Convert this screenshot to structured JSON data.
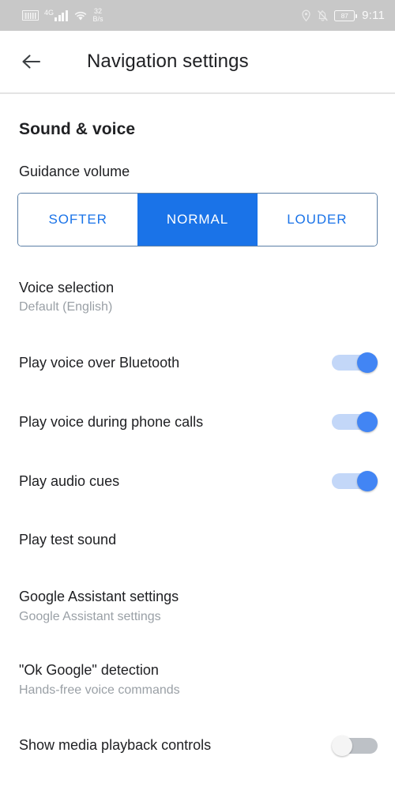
{
  "statusbar": {
    "sim_icon": "sim-card-icon",
    "network_label": "4G",
    "signal_icon": "signal-bars-icon",
    "wifi_icon": "wifi-icon",
    "data_rate_value": "32",
    "data_rate_unit": "B/s",
    "location_icon": "location-pin-icon",
    "notifications_muted_icon": "bell-muted-icon",
    "battery_icon": "battery-icon",
    "battery_level": "87",
    "time": "9:11"
  },
  "appbar": {
    "back_icon": "back-arrow-icon",
    "title": "Navigation settings"
  },
  "sound_voice": {
    "section_title": "Sound & voice",
    "guidance_volume": {
      "label": "Guidance volume",
      "options": [
        "SOFTER",
        "NORMAL",
        "LOUDER"
      ],
      "selected": "NORMAL",
      "selected_bg": "#1a73e8",
      "option_text_color": "#1a73e8",
      "border_color": "#5b7fa6"
    },
    "rows": [
      {
        "name": "voice-selection",
        "title": "Voice selection",
        "subtitle": "Default (English)",
        "control": "none"
      },
      {
        "name": "play-voice-over-bluetooth",
        "title": "Play voice over Bluetooth",
        "subtitle": "",
        "control": "toggle",
        "toggle_state": "on"
      },
      {
        "name": "play-voice-during-phone-calls",
        "title": "Play voice during phone calls",
        "subtitle": "",
        "control": "toggle",
        "toggle_state": "on"
      },
      {
        "name": "play-audio-cues",
        "title": "Play audio cues",
        "subtitle": "",
        "control": "toggle",
        "toggle_state": "on"
      },
      {
        "name": "play-test-sound",
        "title": "Play test sound",
        "subtitle": "",
        "control": "none"
      },
      {
        "name": "google-assistant-settings",
        "title": "Google Assistant settings",
        "subtitle": "Google Assistant settings",
        "control": "none"
      },
      {
        "name": "ok-google-detection",
        "title": "\"Ok Google\" detection",
        "subtitle": "Hands-free voice commands",
        "control": "none"
      },
      {
        "name": "show-media-playback-controls",
        "title": "Show media playback controls",
        "subtitle": "",
        "control": "toggle",
        "toggle_state": "off"
      }
    ]
  },
  "colors": {
    "accent_blue": "#1a73e8",
    "toggle_on_thumb": "#4285f4",
    "toggle_on_track": "#c3d7f8",
    "toggle_off_track": "#bdc1c6",
    "statusbar_bg": "#c8c8c8",
    "text_primary": "#202124",
    "text_secondary": "#9aa0a6"
  }
}
